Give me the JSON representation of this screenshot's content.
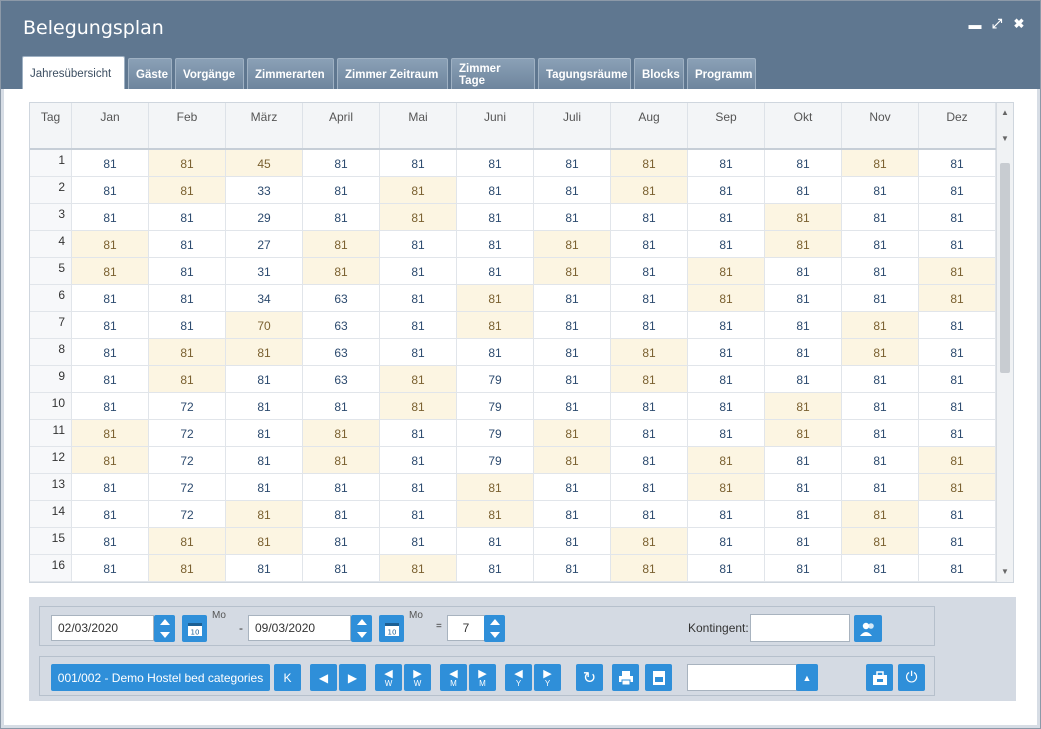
{
  "window": {
    "title": "Belegungsplan"
  },
  "tabs": [
    "Jahresübersicht",
    "Gäste",
    "Vorgänge",
    "Zimmerarten",
    "Zimmer Zeitraum",
    "Zimmer Tage",
    "Tagungsräume",
    "Blocks",
    "Programm"
  ],
  "grid": {
    "day_header": "Tag",
    "months": [
      "Jan",
      "Feb",
      "März",
      "April",
      "Mai",
      "Juni",
      "Juli",
      "Aug",
      "Sep",
      "Okt",
      "Nov",
      "Dez"
    ],
    "rows": [
      {
        "day": "1",
        "values": [
          "81",
          "81",
          "45",
          "81",
          "81",
          "81",
          "81",
          "81",
          "81",
          "81",
          "81",
          "81"
        ],
        "hl": [
          1,
          2,
          7,
          10
        ]
      },
      {
        "day": "2",
        "values": [
          "81",
          "81",
          "33",
          "81",
          "81",
          "81",
          "81",
          "81",
          "81",
          "81",
          "81",
          "81"
        ],
        "hl": [
          1,
          4,
          7
        ]
      },
      {
        "day": "3",
        "values": [
          "81",
          "81",
          "29",
          "81",
          "81",
          "81",
          "81",
          "81",
          "81",
          "81",
          "81",
          "81"
        ],
        "hl": [
          4,
          9
        ]
      },
      {
        "day": "4",
        "values": [
          "81",
          "81",
          "27",
          "81",
          "81",
          "81",
          "81",
          "81",
          "81",
          "81",
          "81",
          "81"
        ],
        "hl": [
          0,
          3,
          6,
          9
        ]
      },
      {
        "day": "5",
        "values": [
          "81",
          "81",
          "31",
          "81",
          "81",
          "81",
          "81",
          "81",
          "81",
          "81",
          "81",
          "81"
        ],
        "hl": [
          0,
          3,
          6,
          8,
          11
        ]
      },
      {
        "day": "6",
        "values": [
          "81",
          "81",
          "34",
          "63",
          "81",
          "81",
          "81",
          "81",
          "81",
          "81",
          "81",
          "81"
        ],
        "hl": [
          5,
          8,
          11
        ]
      },
      {
        "day": "7",
        "values": [
          "81",
          "81",
          "70",
          "63",
          "81",
          "81",
          "81",
          "81",
          "81",
          "81",
          "81",
          "81"
        ],
        "hl": [
          2,
          5,
          10
        ]
      },
      {
        "day": "8",
        "values": [
          "81",
          "81",
          "81",
          "63",
          "81",
          "81",
          "81",
          "81",
          "81",
          "81",
          "81",
          "81"
        ],
        "hl": [
          1,
          2,
          7,
          10
        ]
      },
      {
        "day": "9",
        "values": [
          "81",
          "81",
          "81",
          "63",
          "81",
          "79",
          "81",
          "81",
          "81",
          "81",
          "81",
          "81"
        ],
        "hl": [
          1,
          4,
          7
        ]
      },
      {
        "day": "10",
        "values": [
          "81",
          "72",
          "81",
          "81",
          "81",
          "79",
          "81",
          "81",
          "81",
          "81",
          "81",
          "81"
        ],
        "hl": [
          4,
          9
        ]
      },
      {
        "day": "11",
        "values": [
          "81",
          "72",
          "81",
          "81",
          "81",
          "79",
          "81",
          "81",
          "81",
          "81",
          "81",
          "81"
        ],
        "hl": [
          0,
          3,
          6,
          9
        ]
      },
      {
        "day": "12",
        "values": [
          "81",
          "72",
          "81",
          "81",
          "81",
          "79",
          "81",
          "81",
          "81",
          "81",
          "81",
          "81"
        ],
        "hl": [
          0,
          3,
          6,
          8,
          11
        ]
      },
      {
        "day": "13",
        "values": [
          "81",
          "72",
          "81",
          "81",
          "81",
          "81",
          "81",
          "81",
          "81",
          "81",
          "81",
          "81"
        ],
        "hl": [
          5,
          8,
          11
        ]
      },
      {
        "day": "14",
        "values": [
          "81",
          "72",
          "81",
          "81",
          "81",
          "81",
          "81",
          "81",
          "81",
          "81",
          "81",
          "81"
        ],
        "hl": [
          2,
          5,
          10
        ]
      },
      {
        "day": "15",
        "values": [
          "81",
          "81",
          "81",
          "81",
          "81",
          "81",
          "81",
          "81",
          "81",
          "81",
          "81",
          "81"
        ],
        "hl": [
          1,
          2,
          7,
          10
        ]
      },
      {
        "day": "16",
        "values": [
          "81",
          "81",
          "81",
          "81",
          "81",
          "81",
          "81",
          "81",
          "81",
          "81",
          "81",
          "81"
        ],
        "hl": [
          1,
          4,
          7
        ]
      }
    ]
  },
  "filters": {
    "date_from": "02/03/2020",
    "date_from_weekday": "Mo",
    "separator": "-",
    "date_to": "09/03/2020",
    "date_to_weekday": "Mo",
    "equals": "=",
    "days": "7",
    "kontingent_label": "Kontingent:",
    "kontingent_value": ""
  },
  "toolbar": {
    "category_button": "001/002 - Demo Hostel bed categories",
    "k_button": "K",
    "w_label": "W",
    "m_label": "M",
    "y_label": "Y",
    "select_value": ""
  },
  "colors": {
    "header": "#5f7790",
    "accent": "#2f8fd9",
    "highlight": "#fcf5e2"
  }
}
